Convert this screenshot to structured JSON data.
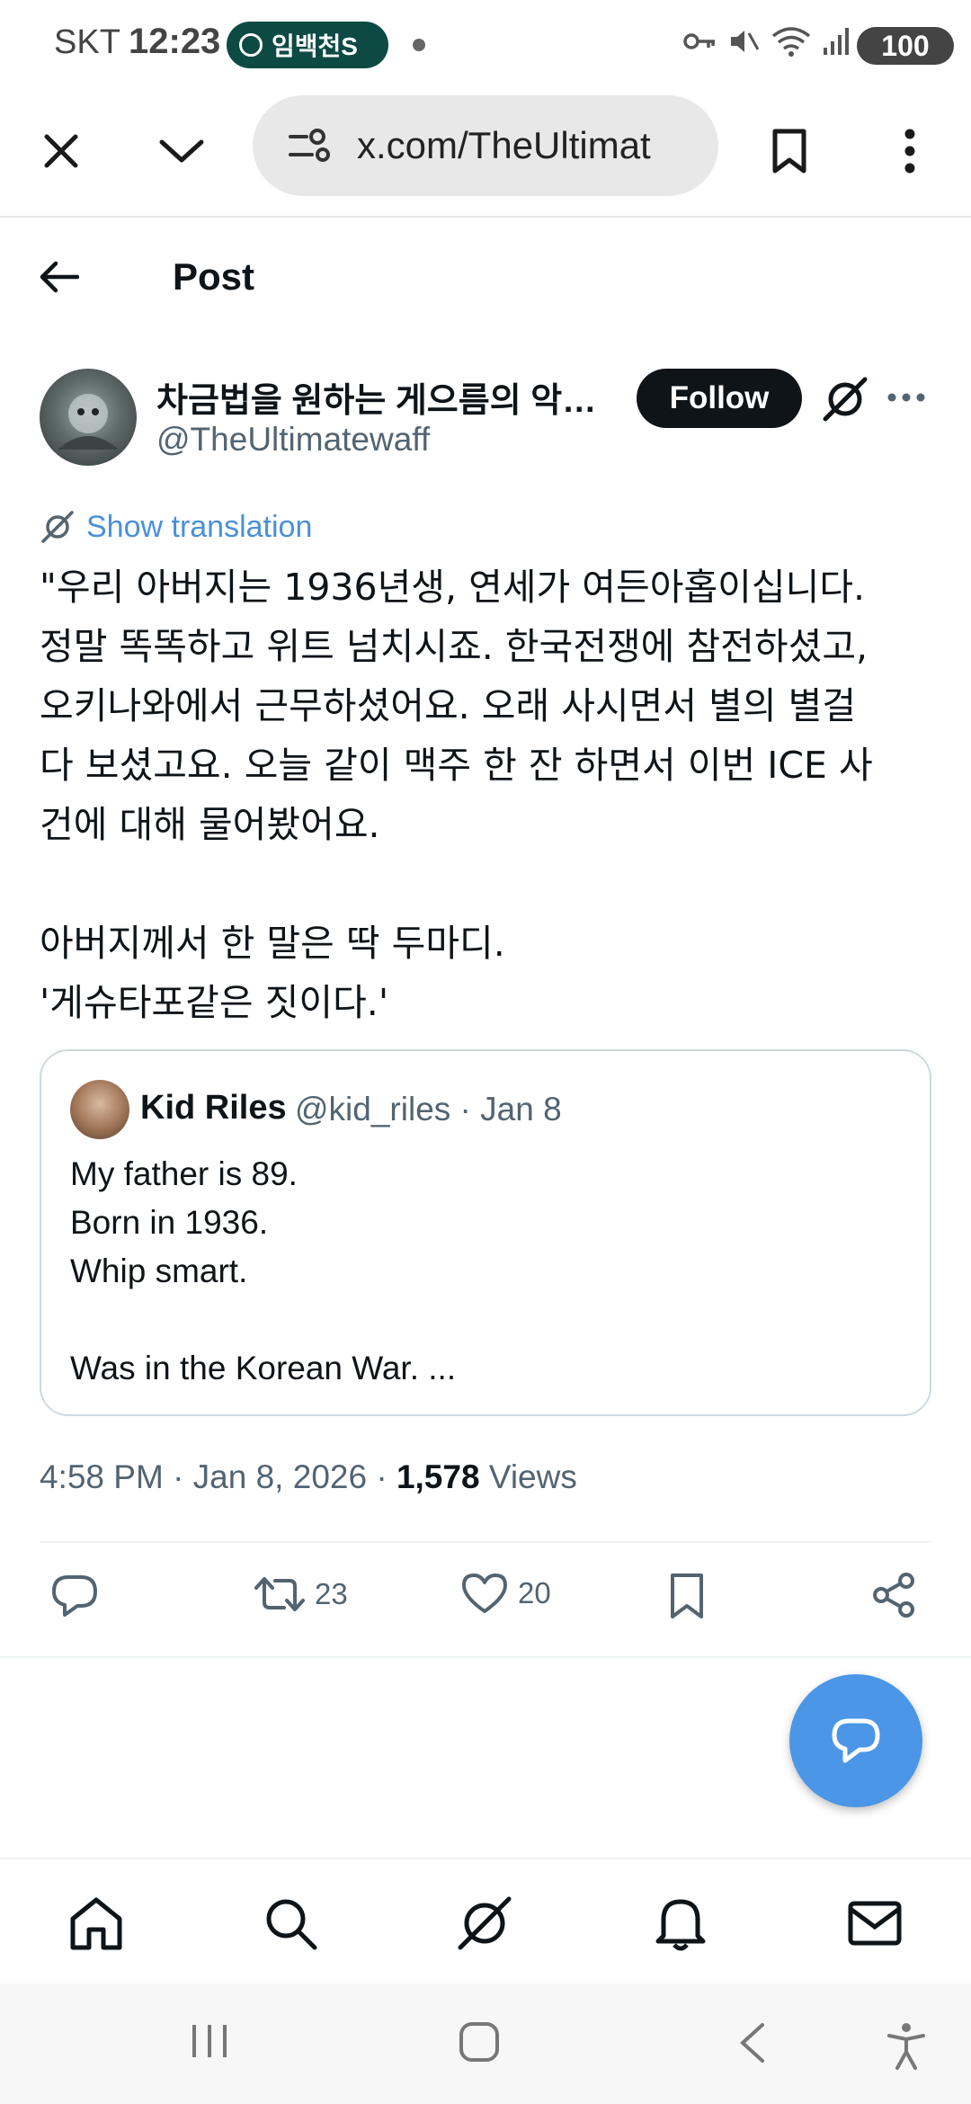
{
  "status_bar": {
    "carrier": "SKT",
    "time": "12:23",
    "notification_pill": "임백천S",
    "battery": "100"
  },
  "browser": {
    "url": "x.com/TheUltimat"
  },
  "header": {
    "title": "Post"
  },
  "post": {
    "author_name": "차금법을 원하는 게으름의 악…",
    "author_handle": "@TheUltimatewaff",
    "follow_label": "Follow",
    "show_translation": "Show translation",
    "text": "\"우리 아버지는 1936년생, 연세가 여든아홉이십니다.\n정말 똑똑하고 위트 넘치시죠. 한국전쟁에 참전하셨고,\n오키나와에서 근무하셨어요. 오래 사시면서 별의 별걸\n다 보셨고요. 오늘 같이 맥주 한 잔 하면서 이번 ICE 사\n건에 대해 물어봤어요.\n\n아버지께서 한 말은 딱 두마디.\n'게슈타포같은 짓이다.'",
    "timestamp": "4:58 PM · Jan 8, 2026 · ",
    "views_count": "1,578",
    "views_label": " Views"
  },
  "quote": {
    "name": "Kid Riles",
    "handle_date": "@kid_riles · Jan 8",
    "text": "My father is 89.\nBorn in 1936.\nWhip smart.\n\nWas in the Korean War. ..."
  },
  "actions": {
    "reposts": "23",
    "likes": "20"
  },
  "icons": {
    "close": "close-icon",
    "chevron": "chevron-down-icon",
    "site_settings": "tune-icon",
    "bookmark": "bookmark-icon",
    "more": "more-vertical-icon",
    "back": "arrow-left-icon",
    "grok": "grok-icon",
    "reply": "reply-icon",
    "repost": "repost-icon",
    "like": "heart-icon",
    "share": "share-icon",
    "home": "home-icon",
    "search": "search-icon",
    "notifications": "bell-icon",
    "messages": "mail-icon"
  },
  "colors": {
    "accent": "#4b96e6",
    "link": "#4a90d9",
    "text": "#0f1419",
    "muted": "#536471",
    "pill": "#0d4a44"
  }
}
